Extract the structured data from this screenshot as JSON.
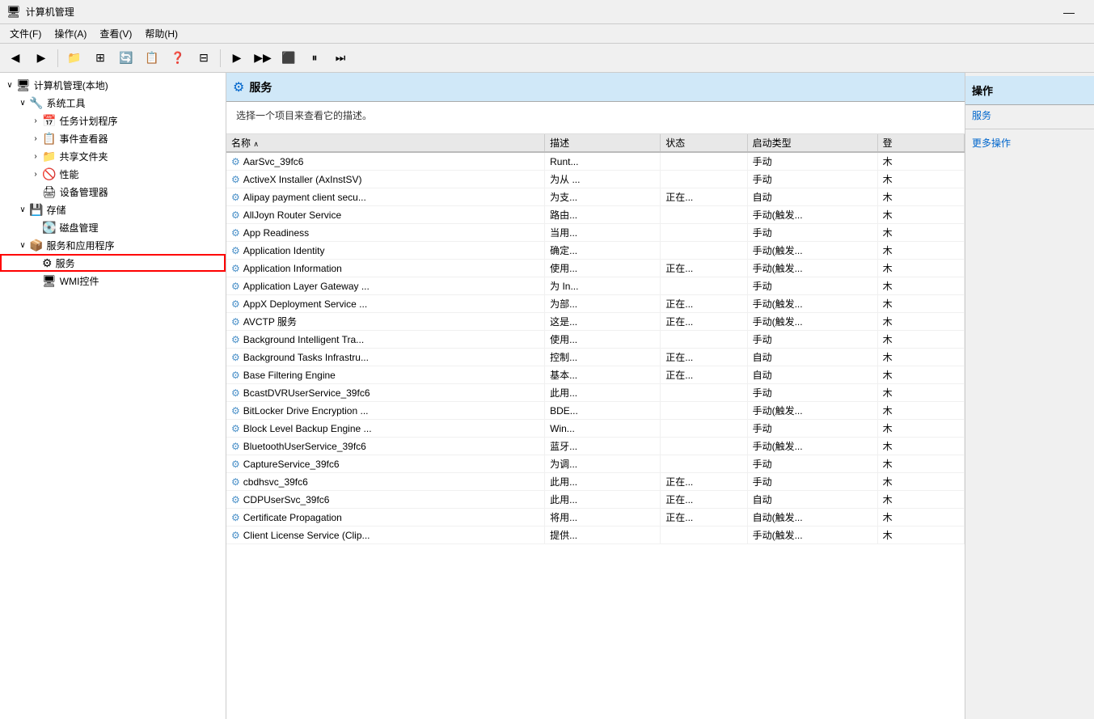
{
  "titleBar": {
    "icon": "🖥",
    "text": "计算机管理",
    "minimizeBtn": "—"
  },
  "menuBar": {
    "items": [
      "文件(F)",
      "操作(A)",
      "查看(V)",
      "帮助(H)"
    ]
  },
  "toolbar": {
    "buttons": [
      "◀",
      "▶",
      "📁",
      "⊞",
      "🔄",
      "📋",
      "❓",
      "⊟",
      "▶",
      "▶▶",
      "⬛",
      "⏸",
      "⏭"
    ]
  },
  "sidebar": {
    "items": [
      {
        "label": "计算机管理(本地)",
        "indent": 0,
        "arrow": "∨",
        "icon": "🖥",
        "selected": false
      },
      {
        "label": "系统工具",
        "indent": 1,
        "arrow": "∨",
        "icon": "🔧",
        "selected": false
      },
      {
        "label": "任务计划程序",
        "indent": 2,
        "arrow": "›",
        "icon": "📅",
        "selected": false
      },
      {
        "label": "事件查看器",
        "indent": 2,
        "arrow": "›",
        "icon": "📋",
        "selected": false
      },
      {
        "label": "共享文件夹",
        "indent": 2,
        "arrow": "›",
        "icon": "📁",
        "selected": false
      },
      {
        "label": "性能",
        "indent": 2,
        "arrow": "›",
        "icon": "🚫",
        "selected": false
      },
      {
        "label": "设备管理器",
        "indent": 2,
        "arrow": "",
        "icon": "🖨",
        "selected": false
      },
      {
        "label": "存储",
        "indent": 1,
        "arrow": "∨",
        "icon": "💾",
        "selected": false
      },
      {
        "label": "磁盘管理",
        "indent": 2,
        "arrow": "",
        "icon": "💽",
        "selected": false
      },
      {
        "label": "服务和应用程序",
        "indent": 1,
        "arrow": "∨",
        "icon": "📦",
        "selected": false
      },
      {
        "label": "服务",
        "indent": 2,
        "arrow": "",
        "icon": "⚙",
        "selected": true
      },
      {
        "label": "WMI控件",
        "indent": 2,
        "arrow": "",
        "icon": "🖥",
        "selected": false
      }
    ]
  },
  "servicesHeader": {
    "icon": "⚙",
    "title": "服务"
  },
  "description": "选择一个项目来查看它的描述。",
  "tableHeaders": {
    "name": "名称",
    "sortArrow": "∧",
    "description": "描述",
    "status": "状态",
    "startupType": "启动类型",
    "login": "登"
  },
  "services": [
    {
      "name": "AarSvc_39fc6",
      "desc": "Runt...",
      "status": "",
      "startup": "手动",
      "login": "木"
    },
    {
      "name": "ActiveX Installer (AxInstSV)",
      "desc": "为从 ...",
      "status": "",
      "startup": "手动",
      "login": "木"
    },
    {
      "name": "Alipay payment client secu...",
      "desc": "为支...",
      "status": "正在...",
      "startup": "自动",
      "login": "木"
    },
    {
      "name": "AllJoyn Router Service",
      "desc": "路由...",
      "status": "",
      "startup": "手动(触发...",
      "login": "木"
    },
    {
      "name": "App Readiness",
      "desc": "当用...",
      "status": "",
      "startup": "手动",
      "login": "木"
    },
    {
      "name": "Application Identity",
      "desc": "确定...",
      "status": "",
      "startup": "手动(触发...",
      "login": "木"
    },
    {
      "name": "Application Information",
      "desc": "使用...",
      "status": "正在...",
      "startup": "手动(触发...",
      "login": "木"
    },
    {
      "name": "Application Layer Gateway ...",
      "desc": "为 In...",
      "status": "",
      "startup": "手动",
      "login": "木"
    },
    {
      "name": "AppX Deployment Service ...",
      "desc": "为部...",
      "status": "正在...",
      "startup": "手动(触发...",
      "login": "木"
    },
    {
      "name": "AVCTP 服务",
      "desc": "这是...",
      "status": "正在...",
      "startup": "手动(触发...",
      "login": "木"
    },
    {
      "name": "Background Intelligent Tra...",
      "desc": "使用...",
      "status": "",
      "startup": "手动",
      "login": "木"
    },
    {
      "name": "Background Tasks Infrastru...",
      "desc": "控制...",
      "status": "正在...",
      "startup": "自动",
      "login": "木"
    },
    {
      "name": "Base Filtering Engine",
      "desc": "基本...",
      "status": "正在...",
      "startup": "自动",
      "login": "木"
    },
    {
      "name": "BcastDVRUserService_39fc6",
      "desc": "此用...",
      "status": "",
      "startup": "手动",
      "login": "木"
    },
    {
      "name": "BitLocker Drive Encryption ...",
      "desc": "BDE...",
      "status": "",
      "startup": "手动(触发...",
      "login": "木"
    },
    {
      "name": "Block Level Backup Engine ...",
      "desc": "Win...",
      "status": "",
      "startup": "手动",
      "login": "木"
    },
    {
      "name": "BluetoothUserService_39fc6",
      "desc": "蓝牙...",
      "status": "",
      "startup": "手动(触发...",
      "login": "木"
    },
    {
      "name": "CaptureService_39fc6",
      "desc": "为调...",
      "status": "",
      "startup": "手动",
      "login": "木"
    },
    {
      "name": "cbdhsvc_39fc6",
      "desc": "此用...",
      "status": "正在...",
      "startup": "手动",
      "login": "木"
    },
    {
      "name": "CDPUserSvc_39fc6",
      "desc": "此用...",
      "status": "正在...",
      "startup": "自动",
      "login": "木"
    },
    {
      "name": "Certificate Propagation",
      "desc": "将用...",
      "status": "正在...",
      "startup": "自动(触发...",
      "login": "木"
    },
    {
      "name": "Client License Service (Clip...",
      "desc": "提供...",
      "status": "",
      "startup": "手动(触发...",
      "login": "木"
    }
  ],
  "rightPanel": {
    "header": "操作",
    "subheader": "服务",
    "actions": [
      "更多操作"
    ]
  }
}
